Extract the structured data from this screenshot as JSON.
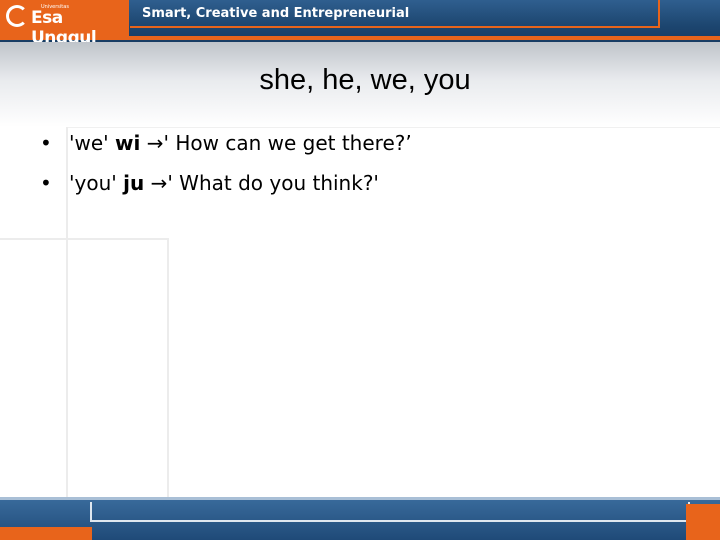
{
  "header": {
    "logo_small_text": "Universitas",
    "logo_name": "Esa Unggul",
    "tagline": "Smart, Creative and Entrepreneurial"
  },
  "slide": {
    "title": "she, he, we, you",
    "bullets": [
      {
        "bullet": "•",
        "pre": "'we' ",
        "bold": "wi",
        "arrow": "→",
        "post": "' How can we get there?’"
      },
      {
        "bullet": "•",
        "pre": "'you' ",
        "bold": "ju",
        "arrow": "→",
        "post": "' What do you think?'"
      }
    ]
  },
  "colors": {
    "brand_orange": "#e8641b",
    "brand_blue": "#1d4670"
  }
}
